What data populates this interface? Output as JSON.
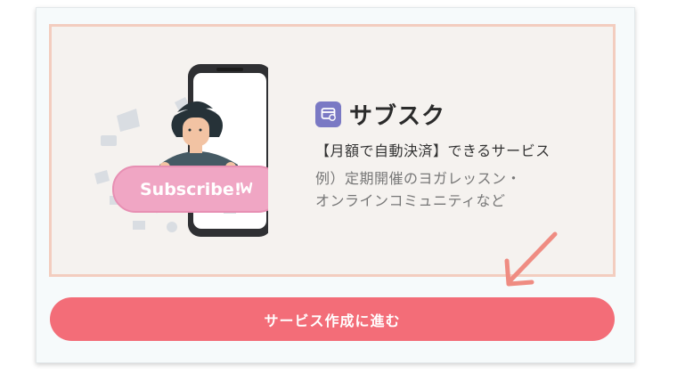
{
  "service": {
    "title": "サブスク",
    "tagline": "【月額で自動決済】できるサービス",
    "example_line1": "例）定期開催のヨガレッスン・",
    "example_line2": "オンラインコミュニティなど",
    "icon": "credit-card-icon"
  },
  "illustration": {
    "badge_text": "Subscribe!"
  },
  "cta": {
    "label": "サービス作成に進む"
  },
  "colors": {
    "accent": "#f36d78",
    "icon_bg": "#7a79c4",
    "panel_border": "#f3cdbf",
    "badge_pink": "#f0a6c4"
  }
}
